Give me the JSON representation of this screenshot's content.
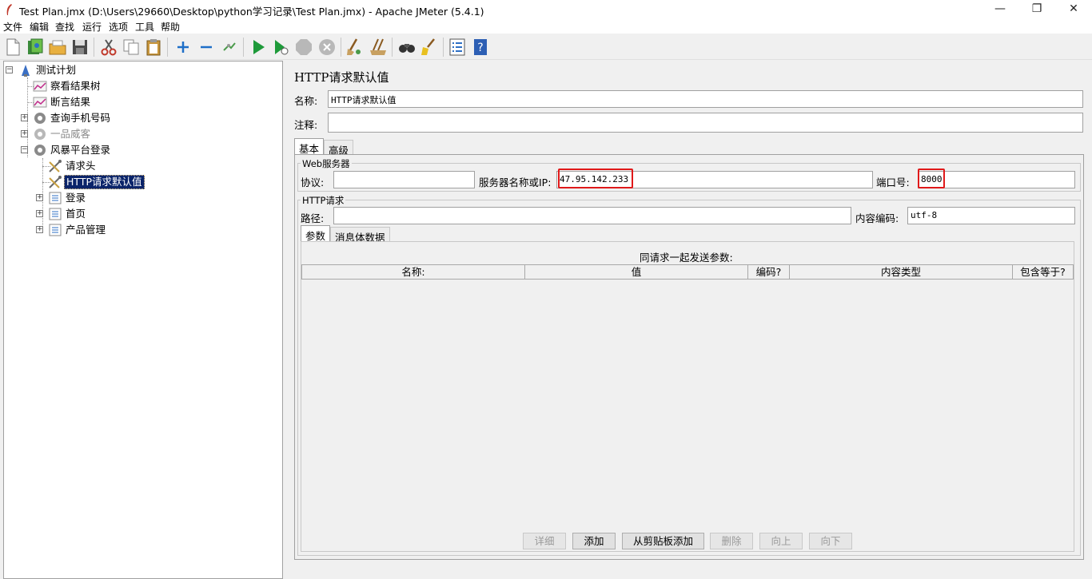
{
  "window": {
    "title": "Test Plan.jmx (D:\\Users\\29660\\Desktop\\python学习记录\\Test Plan.jmx) - Apache JMeter (5.4.1)",
    "minimize": "—",
    "restore": "❐",
    "close": "✕"
  },
  "menu": [
    "文件",
    "编辑",
    "查找",
    "运行",
    "选项",
    "工具",
    "帮助"
  ],
  "toolbar": [
    {
      "name": "new-icon"
    },
    {
      "name": "templates-icon"
    },
    {
      "name": "open-icon"
    },
    {
      "name": "save-icon"
    },
    {
      "name": "cut-icon"
    },
    {
      "name": "copy-icon"
    },
    {
      "name": "paste-icon"
    },
    {
      "name": "expand-all-icon"
    },
    {
      "name": "collapse-all-icon"
    },
    {
      "name": "toggle-icon"
    },
    {
      "name": "start-icon"
    },
    {
      "name": "start-no-pause-icon"
    },
    {
      "name": "stop-icon"
    },
    {
      "name": "shutdown-icon"
    },
    {
      "name": "clear-icon"
    },
    {
      "name": "clear-all-icon"
    },
    {
      "name": "search-icon"
    },
    {
      "name": "reset-search-icon"
    },
    {
      "name": "function-helper-icon"
    },
    {
      "name": "help-icon"
    }
  ],
  "tree": {
    "root": "测试计划",
    "view_results_tree": "察看结果树",
    "assertion_results": "断言结果",
    "thread_group_1": "查询手机号码",
    "thread_group_2": "一品威客",
    "thread_group_3": "风暴平台登录",
    "request_header": "请求头",
    "http_defaults": "HTTP请求默认值",
    "login": "登录",
    "homepage": "首页",
    "product_mgmt": "产品管理"
  },
  "panel": {
    "title": "HTTP请求默认值",
    "name_label": "名称:",
    "name_value": "HTTP请求默认值",
    "comment_label": "注释:",
    "comment_value": "",
    "tab_basic": "基本",
    "tab_advanced": "高级",
    "web_server": {
      "group_title": "Web服务器",
      "protocol_label": "协议:",
      "protocol_value": "",
      "server_label": "服务器名称或IP:",
      "server_value": "47.95.142.233",
      "port_label": "端口号:",
      "port_value": "8000"
    },
    "http_request": {
      "group_title": "HTTP请求",
      "path_label": "路径:",
      "path_value": "",
      "encoding_label": "内容编码:",
      "encoding_value": "utf-8"
    },
    "subtab_params": "参数",
    "subtab_body": "消息体数据",
    "params_caption": "同请求一起发送参数:",
    "columns": [
      "名称:",
      "值",
      "编码?",
      "内容类型",
      "包含等于?"
    ],
    "buttons": {
      "detail": "详细",
      "add": "添加",
      "add_clipboard": "从剪贴板添加",
      "delete": "删除",
      "up": "向上",
      "down": "向下"
    }
  },
  "colors": {
    "selection": "#0a246a",
    "highlight_border": "#e0191a",
    "background": "#f0f0f0"
  }
}
